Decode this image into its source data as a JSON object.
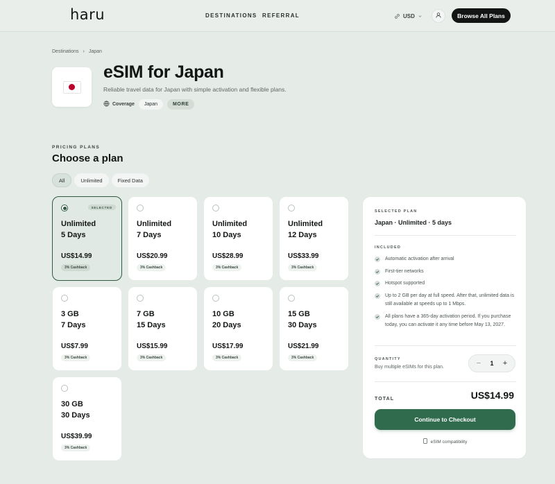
{
  "header": {
    "logo": "haru",
    "nav": [
      "DESTINATIONS",
      "REFERRAL"
    ],
    "currency": "USD",
    "browse_label": "Browse All Plans"
  },
  "breadcrumb": [
    "Destinations",
    "Japan"
  ],
  "hero": {
    "title": "eSIM for Japan",
    "subtitle": "Reliable travel data for Japan with simple activation and flexible plans.",
    "coverage_label": "Coverage",
    "coverage_country": "Japan",
    "more_label": "MORE"
  },
  "plans_section": {
    "kicker": "PRICING PLANS",
    "title": "Choose a plan",
    "filters": [
      "All",
      "Unlimited",
      "Fixed Data"
    ],
    "selected_badge": "SELECTED",
    "cards": [
      {
        "name": "Unlimited\n5 Days",
        "price": "US$14.99",
        "cashback": "3% Cashback"
      },
      {
        "name": "Unlimited\n7 Days",
        "price": "US$20.99",
        "cashback": "3% Cashback"
      },
      {
        "name": "Unlimited\n10 Days",
        "price": "US$28.99",
        "cashback": "3% Cashback"
      },
      {
        "name": "Unlimited\n12 Days",
        "price": "US$33.99",
        "cashback": "3% Cashback"
      },
      {
        "name": "3 GB\n7 Days",
        "price": "US$7.99",
        "cashback": "3% Cashback"
      },
      {
        "name": "7 GB\n15 Days",
        "price": "US$15.99",
        "cashback": "3% Cashback"
      },
      {
        "name": "10 GB\n20 Days",
        "price": "US$17.99",
        "cashback": "3% Cashback"
      },
      {
        "name": "15 GB\n30 Days",
        "price": "US$21.99",
        "cashback": "3% Cashback"
      },
      {
        "name": "30 GB\n30 Days",
        "price": "US$39.99",
        "cashback": "3% Cashback"
      }
    ]
  },
  "summary": {
    "selected_kicker": "SELECTED PLAN",
    "selected_plan": "Japan · Unlimited · 5 days",
    "included_kicker": "INCLUDED",
    "features": [
      "Automatic activation after arrival",
      "First-tier networks",
      "Hotspot supported",
      "Up to 2 GB per day at full speed. After that, unlimited data is still available at speeds up to 1 Mbps.",
      "All plans have a 365-day activation period. If you purchase today, you can activate it any time before May 13, 2027."
    ],
    "quantity_label": "QUANTITY",
    "quantity_hint": "Buy multiple eSIMs for this plan.",
    "quantity_minus": "−",
    "quantity_plus": "+",
    "quantity": "1",
    "total_label": "TOTAL",
    "total": "US$14.99",
    "checkout_label": "Continue to Checkout",
    "compat_label": "eSIM compatibility"
  },
  "colors": {
    "accent": "#2f6b4c",
    "selected_border": "#2f5a42",
    "background": "#e5ebe7"
  }
}
